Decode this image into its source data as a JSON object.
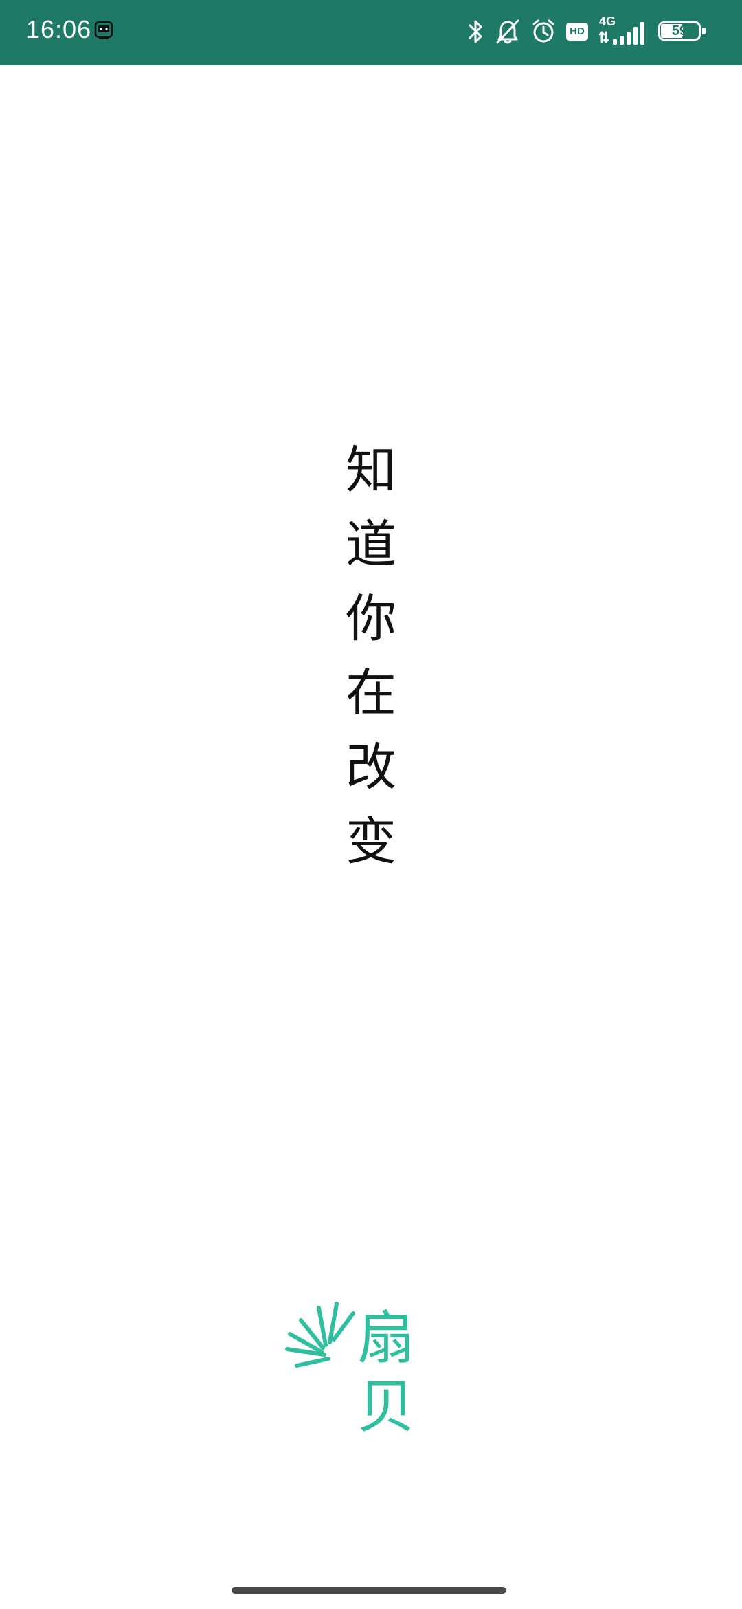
{
  "status_bar": {
    "time": "16:06",
    "network_type": "4G",
    "hd_label": "HD",
    "battery_level": "59",
    "background_color": "#1e7a66",
    "icons": [
      "notification-app-icon",
      "bluetooth-icon",
      "bell-muted-icon",
      "alarm-icon",
      "hd-icon",
      "signal-icon",
      "battery-icon"
    ]
  },
  "splash": {
    "slogan_chars": [
      "知",
      "道",
      "你",
      "在",
      "改",
      "变"
    ]
  },
  "brand": {
    "name": "扇贝",
    "color": "#2fbf9f",
    "icon": "shanbay-shell-logo-icon"
  },
  "nav": {
    "home_indicator": "home-indicator"
  }
}
